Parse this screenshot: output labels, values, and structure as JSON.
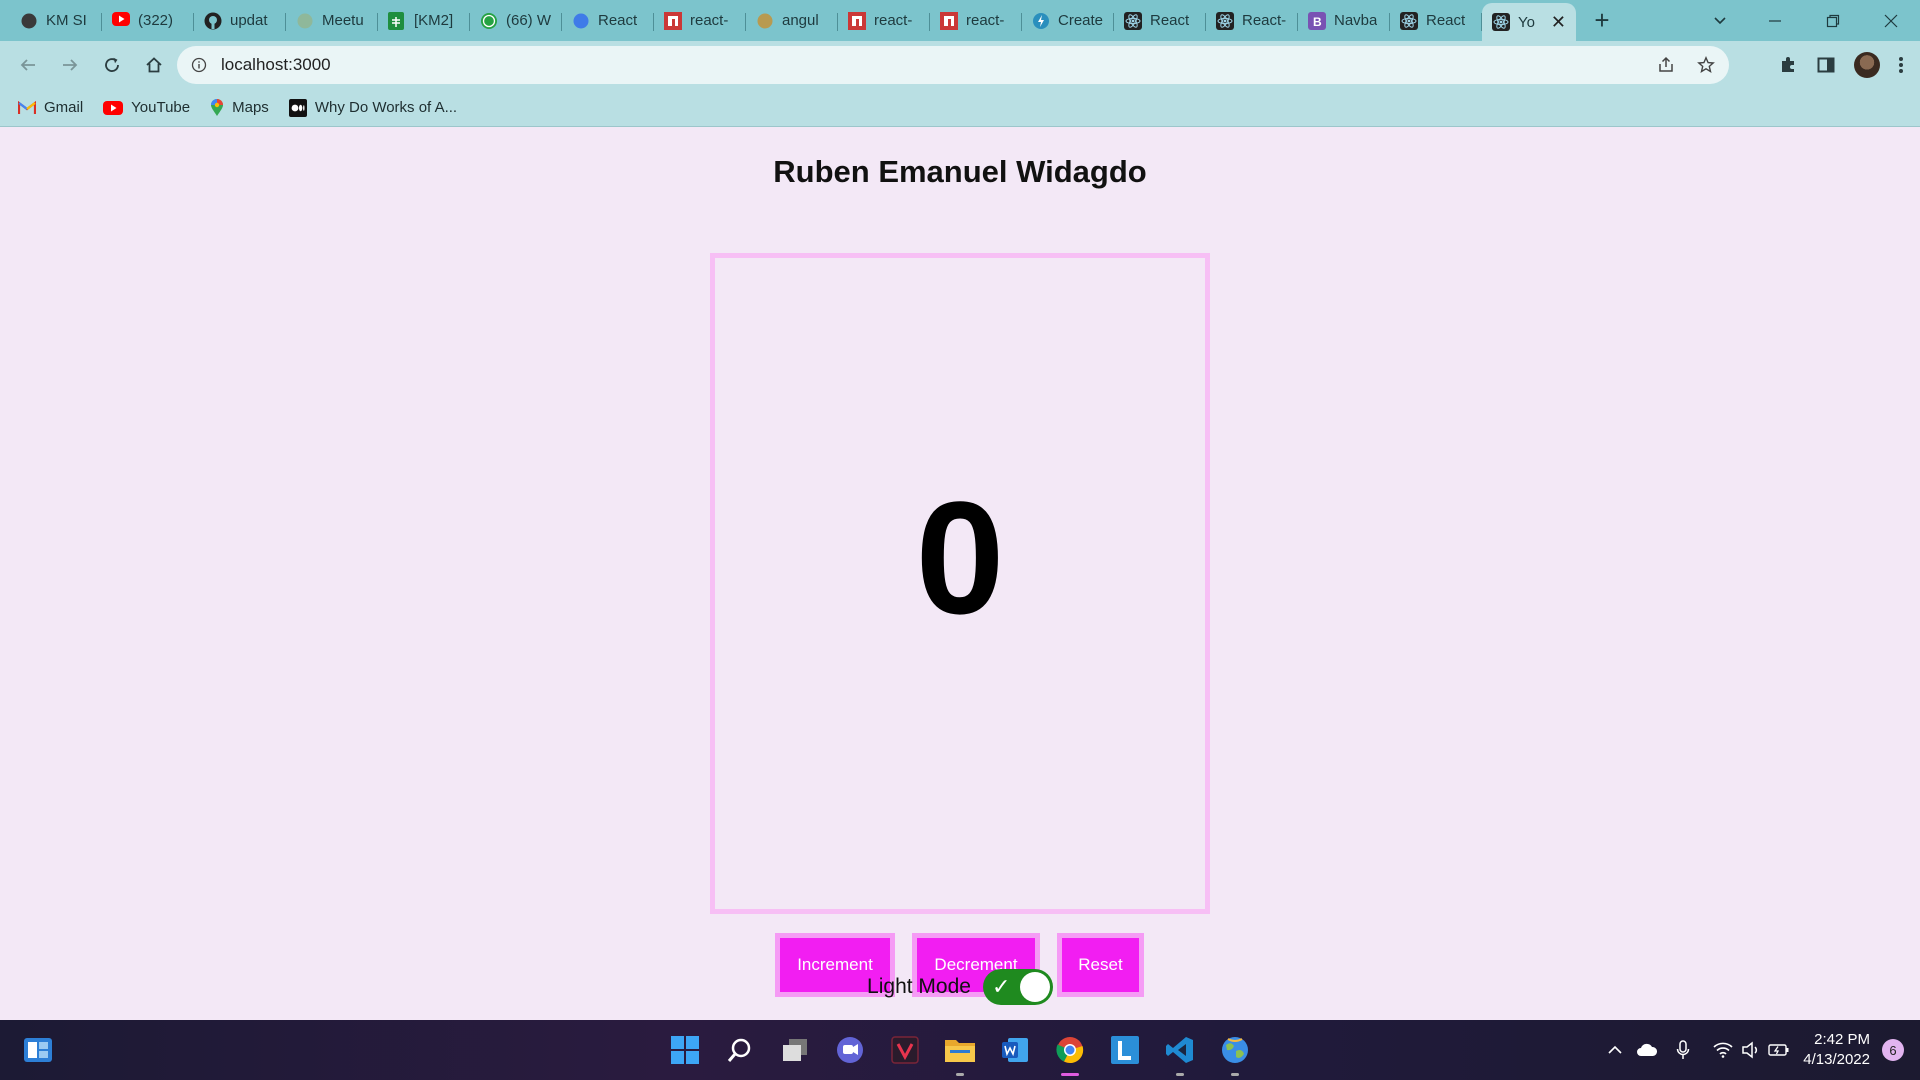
{
  "browser": {
    "tabs": [
      {
        "label": "KM SI",
        "icon": "contact-icon",
        "color": "#3a3a3a"
      },
      {
        "label": "(322)",
        "icon": "youtube-icon",
        "color": "#ff0000"
      },
      {
        "label": "updat",
        "icon": "github-icon",
        "color": "#222222"
      },
      {
        "label": "Meetu",
        "icon": "meetup-icon",
        "color": "#8fb89a"
      },
      {
        "label": "[KM2]",
        "icon": "sheets-icon",
        "color": "#1e8e3e"
      },
      {
        "label": "(66) W",
        "icon": "whatsapp-icon",
        "color": "#25a244"
      },
      {
        "label": "React",
        "icon": "react-hook-form-icon",
        "color": "#3f7be8"
      },
      {
        "label": "react-",
        "icon": "npm-icon",
        "color": "#cb3837"
      },
      {
        "label": "angul",
        "icon": "pencil-icon",
        "color": "#b89a50"
      },
      {
        "label": "react-",
        "icon": "npm-icon",
        "color": "#cb3837"
      },
      {
        "label": "react-",
        "icon": "npm-icon",
        "color": "#cb3837"
      },
      {
        "label": "Create",
        "icon": "bolt-icon",
        "color": "#2a8fbd"
      },
      {
        "label": "React",
        "icon": "react-icon",
        "color": "#222222"
      },
      {
        "label": "React-",
        "icon": "react-icon",
        "color": "#222222"
      },
      {
        "label": "Navba",
        "icon": "bootstrap-icon",
        "color": "#7952b3"
      },
      {
        "label": "React",
        "icon": "react-icon",
        "color": "#222222"
      }
    ],
    "active_tab": {
      "label": "Yo",
      "icon": "react-icon",
      "close": "✕"
    },
    "new_tab": "+",
    "url": "localhost:3000",
    "bookmarks": [
      {
        "label": "Gmail",
        "icon": "gmail-icon"
      },
      {
        "label": "YouTube",
        "icon": "youtube-icon"
      },
      {
        "label": "Maps",
        "icon": "maps-icon"
      },
      {
        "label": "Why Do Works of A...",
        "icon": "medium-icon"
      }
    ]
  },
  "app": {
    "title": "Ruben Emanuel Widagdo",
    "counter_value": "0",
    "buttons": {
      "increment": "Increment",
      "decrement": "Decrement",
      "reset": "Reset"
    },
    "mode_label": "Light Mode",
    "mode_toggle_on": true,
    "colors": {
      "background": "#f3e8f6",
      "card_border": "#f7bff5",
      "button_fill": "#f21ef2",
      "button_border": "#f59bf5",
      "toggle_on": "#1f8a1f"
    }
  },
  "taskbar": {
    "apps": [
      "windows-start-icon",
      "search-icon",
      "task-view-icon",
      "teams-chat-icon",
      "vivaldi-icon",
      "file-explorer-icon",
      "word-icon",
      "chrome-icon",
      "l-app-icon",
      "vscode-icon",
      "earth-app-icon"
    ],
    "time": "2:42 PM",
    "date": "4/13/2022",
    "notification_count": "6"
  }
}
